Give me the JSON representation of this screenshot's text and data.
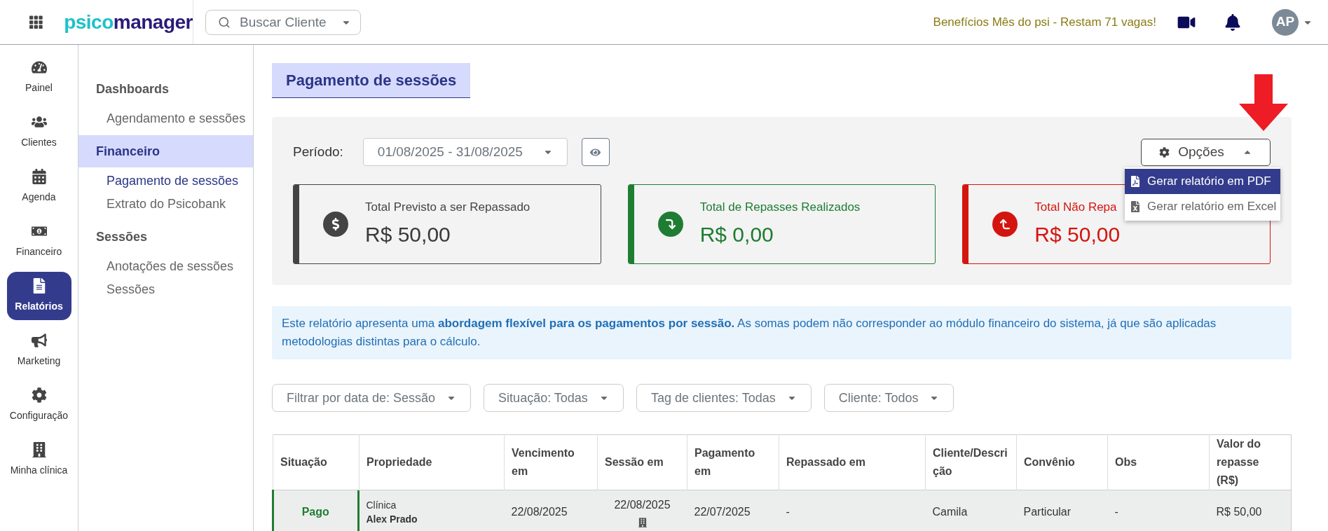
{
  "topbar": {
    "logo_parts": [
      "psico",
      "manager"
    ],
    "search": {
      "placeholder": "Buscar Cliente"
    },
    "promo": "Benefícios Mês do psi - Restam 71 vagas!",
    "avatar": "AP"
  },
  "rail": [
    {
      "label": "Painel",
      "selected": false
    },
    {
      "label": "Clientes",
      "selected": false
    },
    {
      "label": "Agenda",
      "selected": false
    },
    {
      "label": "Financeiro",
      "selected": false
    },
    {
      "label": "Relatórios",
      "selected": true
    },
    {
      "label": "Marketing",
      "selected": false
    },
    {
      "label": "Configuração",
      "selected": false
    },
    {
      "label": "Minha clínica",
      "selected": false
    }
  ],
  "submenu": [
    {
      "title": "Dashboards",
      "selected": false,
      "items": [
        {
          "label": "Agendamento e sessões",
          "selected": false
        }
      ]
    },
    {
      "title": "Financeiro",
      "selected": true,
      "items": [
        {
          "label": "Pagamento de sessões",
          "selected": true
        },
        {
          "label": "Extrato do Psicobank",
          "selected": false
        }
      ]
    },
    {
      "title": "Sessões",
      "selected": false,
      "items": [
        {
          "label": "Anotações de sessões",
          "selected": false
        },
        {
          "label": "Sessões",
          "selected": false
        }
      ]
    }
  ],
  "page_title": "Pagamento de sessões",
  "period": {
    "label": "Período:",
    "value": "01/08/2025 - 31/08/2025"
  },
  "options": {
    "label": "Opções",
    "expanded": true,
    "menu": [
      {
        "label": "Gerar relatório em PDF",
        "kind": "pdf",
        "selected": true
      },
      {
        "label": "Gerar relatório em Excel",
        "kind": "excel",
        "selected": false
      }
    ]
  },
  "cards": [
    {
      "kind": "neutral",
      "title": "Total Previsto a ser Repassado",
      "value": "R$ 50,00"
    },
    {
      "kind": "success",
      "title": "Total de Repasses Realizados",
      "value": "R$ 0,00"
    },
    {
      "kind": "danger",
      "title": "Total Não Repa",
      "value": "R$ 50,00"
    }
  ],
  "notice": "Este relatório apresenta uma **abordagem flexível para os pagamentos por sessão.** As somas podem não corresponder ao módulo financeiro do sistema, já que são aplicadas metodologias distintas para o cálculo.",
  "filters": [
    "Filtrar por data de: Sessão",
    "Situação: Todas",
    "Tag de clientes: Todas",
    "Cliente: Todos"
  ],
  "table": {
    "columns": [
      "Situação",
      "Propriedade",
      "Vencimento em",
      "Sessão em",
      "Pagamento em",
      "Repassado em",
      "Cliente/Descrição",
      "Convênio",
      "Obs",
      "Valor do repasse (R$)"
    ],
    "rows": [
      {
        "status": "Pago",
        "property_type": "Clínica",
        "property_name": "Alex Prado",
        "due": "22/08/2025",
        "session": "22/08/2025",
        "payment": "22/07/2025",
        "transferred": "-",
        "client": "Camila",
        "plan": "Particular",
        "obs": "-",
        "amount": "R$ 50,00"
      }
    ]
  }
}
